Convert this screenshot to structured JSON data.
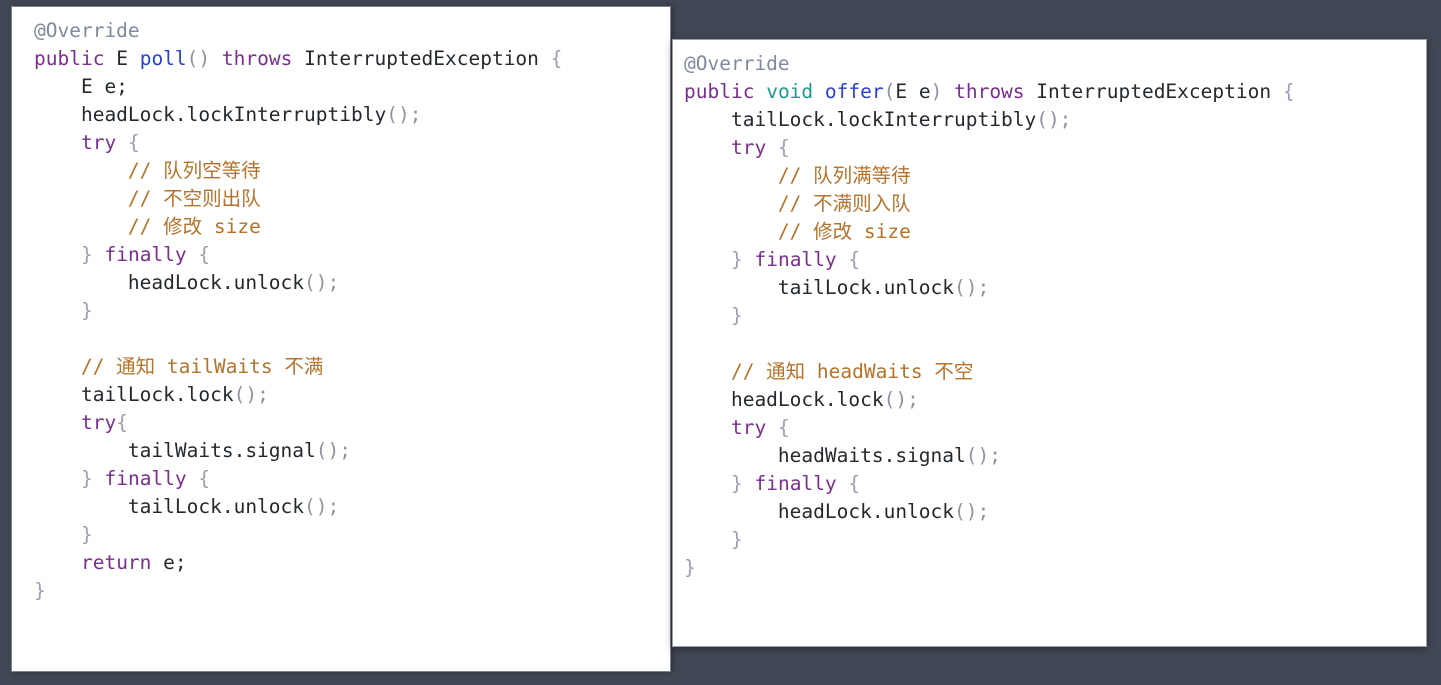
{
  "window": {
    "background_color": "#414754",
    "panel_background": "#ffffff"
  },
  "theme": {
    "annotation_color": "#808a9c",
    "keyword_color": "#7a2f8f",
    "type_color": "#1a9a8f",
    "method_color": "#2b3fd0",
    "comment_color": "#b5732a",
    "plain_color": "#24292e",
    "brace_color": "#9aa0b0"
  },
  "panels": [
    {
      "name": "poll-method-panel",
      "language": "java",
      "lines": [
        [
          {
            "t": "@Override",
            "c": "annotation"
          }
        ],
        [
          {
            "t": "public",
            "c": "keyword"
          },
          {
            "t": " ",
            "c": "plain"
          },
          {
            "t": "E",
            "c": "plain"
          },
          {
            "t": " ",
            "c": "plain"
          },
          {
            "t": "poll",
            "c": "method"
          },
          {
            "t": "() ",
            "c": "punct"
          },
          {
            "t": "throws",
            "c": "keyword"
          },
          {
            "t": " ",
            "c": "plain"
          },
          {
            "t": "InterruptedException",
            "c": "plain"
          },
          {
            "t": " ",
            "c": "plain"
          },
          {
            "t": "{",
            "c": "brace"
          }
        ],
        [
          {
            "t": "    E e;",
            "c": "plain"
          }
        ],
        [
          {
            "t": "    headLock.lockInterruptibly",
            "c": "plain"
          },
          {
            "t": "();",
            "c": "punct"
          }
        ],
        [
          {
            "t": "    ",
            "c": "plain"
          },
          {
            "t": "try",
            "c": "keyword"
          },
          {
            "t": " ",
            "c": "plain"
          },
          {
            "t": "{",
            "c": "brace"
          }
        ],
        [
          {
            "t": "        // 队列空等待",
            "c": "comment"
          }
        ],
        [
          {
            "t": "        // 不空则出队",
            "c": "comment"
          }
        ],
        [
          {
            "t": "        // 修改 size",
            "c": "comment"
          }
        ],
        [
          {
            "t": "    ",
            "c": "plain"
          },
          {
            "t": "}",
            "c": "brace"
          },
          {
            "t": " ",
            "c": "plain"
          },
          {
            "t": "finally",
            "c": "keyword"
          },
          {
            "t": " ",
            "c": "plain"
          },
          {
            "t": "{",
            "c": "brace"
          }
        ],
        [
          {
            "t": "        headLock.unlock",
            "c": "plain"
          },
          {
            "t": "();",
            "c": "punct"
          }
        ],
        [
          {
            "t": "    ",
            "c": "plain"
          },
          {
            "t": "}",
            "c": "brace"
          }
        ],
        [
          {
            "t": "",
            "c": "plain"
          }
        ],
        [
          {
            "t": "    // 通知 tailWaits 不满",
            "c": "comment"
          }
        ],
        [
          {
            "t": "    tailLock.lock",
            "c": "plain"
          },
          {
            "t": "();",
            "c": "punct"
          }
        ],
        [
          {
            "t": "    ",
            "c": "plain"
          },
          {
            "t": "try",
            "c": "keyword"
          },
          {
            "t": "{",
            "c": "brace"
          }
        ],
        [
          {
            "t": "        tailWaits.signal",
            "c": "plain"
          },
          {
            "t": "();",
            "c": "punct"
          }
        ],
        [
          {
            "t": "    ",
            "c": "plain"
          },
          {
            "t": "}",
            "c": "brace"
          },
          {
            "t": " ",
            "c": "plain"
          },
          {
            "t": "finally",
            "c": "keyword"
          },
          {
            "t": " ",
            "c": "plain"
          },
          {
            "t": "{",
            "c": "brace"
          }
        ],
        [
          {
            "t": "        tailLock.unlock",
            "c": "plain"
          },
          {
            "t": "();",
            "c": "punct"
          }
        ],
        [
          {
            "t": "    ",
            "c": "plain"
          },
          {
            "t": "}",
            "c": "brace"
          }
        ],
        [
          {
            "t": "    ",
            "c": "plain"
          },
          {
            "t": "return",
            "c": "keyword"
          },
          {
            "t": " e;",
            "c": "plain"
          }
        ],
        [
          {
            "t": "}",
            "c": "brace"
          }
        ]
      ]
    },
    {
      "name": "offer-method-panel",
      "language": "java",
      "lines": [
        [
          {
            "t": "@Override",
            "c": "annotation"
          }
        ],
        [
          {
            "t": "public",
            "c": "keyword"
          },
          {
            "t": " ",
            "c": "plain"
          },
          {
            "t": "void",
            "c": "type"
          },
          {
            "t": " ",
            "c": "plain"
          },
          {
            "t": "offer",
            "c": "method"
          },
          {
            "t": "(",
            "c": "punct"
          },
          {
            "t": "E e",
            "c": "plain"
          },
          {
            "t": ") ",
            "c": "punct"
          },
          {
            "t": "throws",
            "c": "keyword"
          },
          {
            "t": " ",
            "c": "plain"
          },
          {
            "t": "InterruptedException",
            "c": "plain"
          },
          {
            "t": " ",
            "c": "plain"
          },
          {
            "t": "{",
            "c": "brace"
          }
        ],
        [
          {
            "t": "    tailLock.lockInterruptibly",
            "c": "plain"
          },
          {
            "t": "();",
            "c": "punct"
          }
        ],
        [
          {
            "t": "    ",
            "c": "plain"
          },
          {
            "t": "try",
            "c": "keyword"
          },
          {
            "t": " ",
            "c": "plain"
          },
          {
            "t": "{",
            "c": "brace"
          }
        ],
        [
          {
            "t": "        // 队列满等待",
            "c": "comment"
          }
        ],
        [
          {
            "t": "        // 不满则入队",
            "c": "comment"
          }
        ],
        [
          {
            "t": "        // 修改 size",
            "c": "comment"
          }
        ],
        [
          {
            "t": "    ",
            "c": "plain"
          },
          {
            "t": "}",
            "c": "brace"
          },
          {
            "t": " ",
            "c": "plain"
          },
          {
            "t": "finally",
            "c": "keyword"
          },
          {
            "t": " ",
            "c": "plain"
          },
          {
            "t": "{",
            "c": "brace"
          }
        ],
        [
          {
            "t": "        tailLock.unlock",
            "c": "plain"
          },
          {
            "t": "();",
            "c": "punct"
          }
        ],
        [
          {
            "t": "    ",
            "c": "plain"
          },
          {
            "t": "}",
            "c": "brace"
          }
        ],
        [
          {
            "t": "",
            "c": "plain"
          }
        ],
        [
          {
            "t": "    // 通知 headWaits 不空",
            "c": "comment"
          }
        ],
        [
          {
            "t": "    headLock.lock",
            "c": "plain"
          },
          {
            "t": "();",
            "c": "punct"
          }
        ],
        [
          {
            "t": "    ",
            "c": "plain"
          },
          {
            "t": "try",
            "c": "keyword"
          },
          {
            "t": " ",
            "c": "plain"
          },
          {
            "t": "{",
            "c": "brace"
          }
        ],
        [
          {
            "t": "        headWaits.signal",
            "c": "plain"
          },
          {
            "t": "();",
            "c": "punct"
          }
        ],
        [
          {
            "t": "    ",
            "c": "plain"
          },
          {
            "t": "}",
            "c": "brace"
          },
          {
            "t": " ",
            "c": "plain"
          },
          {
            "t": "finally",
            "c": "keyword"
          },
          {
            "t": " ",
            "c": "plain"
          },
          {
            "t": "{",
            "c": "brace"
          }
        ],
        [
          {
            "t": "        headLock.unlock",
            "c": "plain"
          },
          {
            "t": "();",
            "c": "punct"
          }
        ],
        [
          {
            "t": "    ",
            "c": "plain"
          },
          {
            "t": "}",
            "c": "brace"
          }
        ],
        [
          {
            "t": "}",
            "c": "brace"
          }
        ]
      ]
    }
  ]
}
